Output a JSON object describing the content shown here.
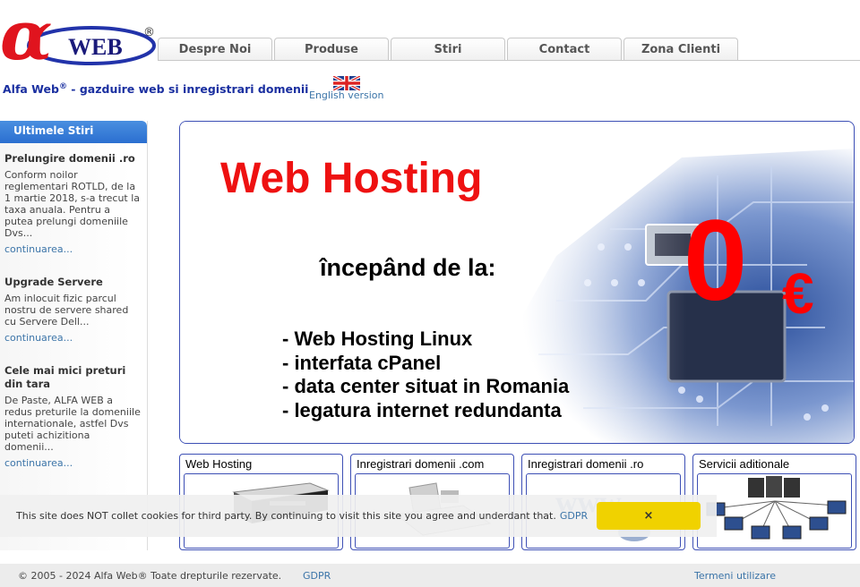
{
  "logo": {
    "alpha": "α",
    "text": "WEB",
    "reg": "®"
  },
  "nav": {
    "tabs": [
      "Despre Noi",
      "Produse",
      "Stiri",
      "Contact",
      "Zona Clienti"
    ]
  },
  "header": {
    "brand": "Alfa Web",
    "reg": "®",
    "tagline_rest": " - gazduire web si inregistrari domenii",
    "english_link": "English version",
    "flag_icon": "uk-flag-icon"
  },
  "sidebar": {
    "title": "Ultimele Stiri",
    "news": [
      {
        "title": "Prelungire domenii .ro",
        "text": "Conform noilor reglementari ROTLD, de la 1 martie 2018, s-a trecut la taxa anuala. Pentru a putea prelungi domeniile Dvs...",
        "more": "continuarea..."
      },
      {
        "title": "Upgrade Servere",
        "text": "Am inlocuit fizic parcul nostru de servere shared cu Servere Dell...",
        "more": "continuarea..."
      },
      {
        "title": "Cele mai mici preturi din tara",
        "text": "De Paste, ALFA WEB a redus preturile la domeniile internationale, astfel Dvs puteti achizitiona domenii...",
        "more": "continuarea..."
      }
    ]
  },
  "banner": {
    "title": "Web Hosting",
    "from": "începând de la:",
    "price": "0",
    "currency": "€",
    "features": [
      "- Web Hosting Linux",
      "- interfata cPanel",
      "- data center situat in Romania",
      "- legatura internet redundanta"
    ]
  },
  "services": [
    {
      "title": "Web Hosting",
      "icon": "server-icon"
    },
    {
      "title": "Inregistrari domenii .com",
      "icon": "laptop-icon"
    },
    {
      "title": "Inregistrari domenii .ro",
      "icon": "www-icon"
    },
    {
      "title": "Servicii aditionale",
      "icon": "network-icon"
    }
  ],
  "cookie": {
    "text": "This site does NOT collet cookies for third party. By continuing to visit this site you agree and underdant that.",
    "gdpr": "GDPR",
    "close": "×"
  },
  "footer": {
    "copyright": "© 2005 - 2024 Alfa Web® Toate drepturile rezervate.",
    "gdpr": "GDPR",
    "terms": "Termeni utilizare"
  },
  "colors": {
    "accent_blue": "#1a2fa0",
    "link": "#3b74a8",
    "price_red": "#ff0000",
    "cookie_button": "#f0d200"
  }
}
